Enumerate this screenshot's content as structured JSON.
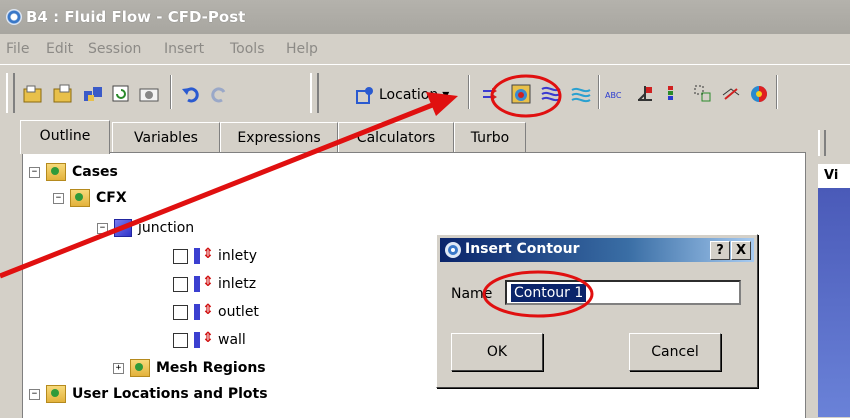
{
  "window": {
    "title": "B4 : Fluid Flow - CFD-Post"
  },
  "menu": [
    "File",
    "Edit",
    "Session",
    "Insert",
    "Tools",
    "Help"
  ],
  "toolbar": {
    "location_label": "Location",
    "icons": [
      "open-icon",
      "save-icon",
      "print-icon",
      "refresh-icon",
      "camera-icon",
      "undo-icon",
      "redo-icon",
      "location-icon",
      "vector-icon",
      "contour-icon",
      "streamline-icon",
      "volume-icon",
      "text-icon",
      "clip-icon",
      "legend-icon",
      "chart-icon",
      "polyline-icon",
      "color-icon"
    ]
  },
  "tabs": [
    "Outline",
    "Variables",
    "Expressions",
    "Calculators",
    "Turbo"
  ],
  "tree": {
    "cases": "Cases",
    "cfx": "CFX",
    "junction": "junction",
    "boundaries": [
      "inlety",
      "inletz",
      "outlet",
      "wall"
    ],
    "mesh_regions": "Mesh Regions",
    "user_locations": "User Locations and Plots"
  },
  "right_panel": {
    "label": "Vi"
  },
  "dialog": {
    "title": "Insert Contour",
    "help_label": "?",
    "close_label": "X",
    "name_label": "Name",
    "name_value": "Contour 1",
    "ok_label": "OK",
    "cancel_label": "Cancel"
  },
  "colors": {
    "annotation": "#e01010",
    "dialog_title": "#0a246a"
  }
}
